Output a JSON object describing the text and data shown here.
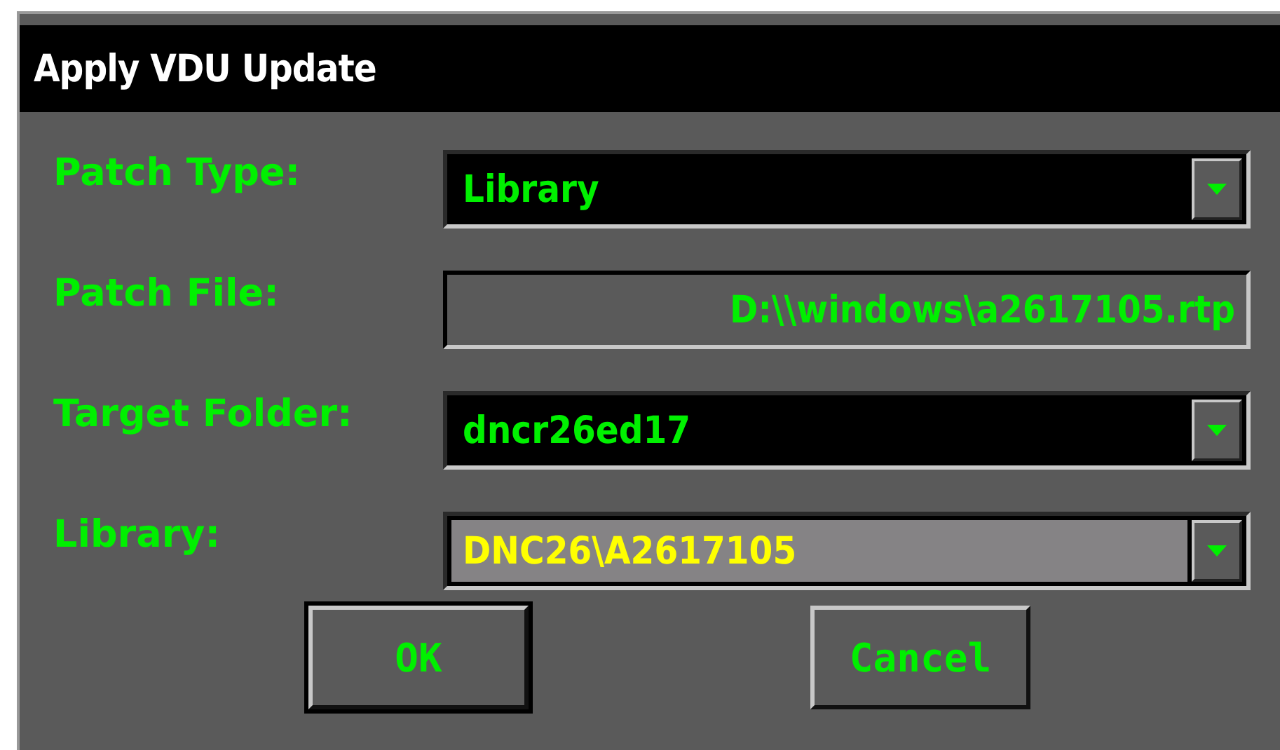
{
  "window": {
    "title": "Apply VDU Update"
  },
  "fields": [
    {
      "label": "Patch Type:",
      "kind": "dropdown",
      "value": "Library",
      "focused": false
    },
    {
      "label": "Patch File:",
      "kind": "text",
      "value": "D:\\\\windows\\a2617105.rtp",
      "focused": false
    },
    {
      "label": "Target Folder:",
      "kind": "dropdown",
      "value": "dncr26ed17",
      "focused": false
    },
    {
      "label": "Library:",
      "kind": "dropdown",
      "value": "DNC26\\A2617105",
      "focused": true
    }
  ],
  "buttons": [
    {
      "label": "OK",
      "default": true
    },
    {
      "label": "Cancel",
      "default": false
    }
  ]
}
